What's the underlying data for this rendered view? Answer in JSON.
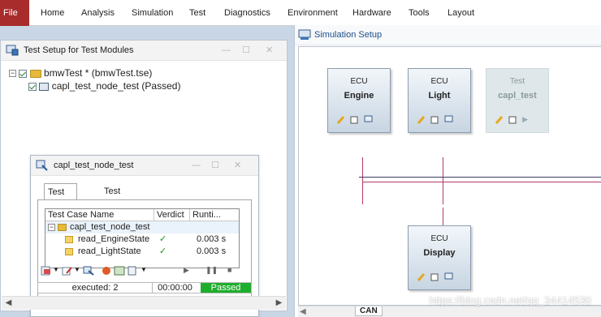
{
  "ribbon": {
    "tabs": [
      "File",
      "Home",
      "Analysis",
      "Simulation",
      "Test",
      "Diagnostics",
      "Environment",
      "Hardware",
      "Tools",
      "Layout"
    ]
  },
  "test_setup": {
    "title": "Test Setup for Test Modules",
    "tree": {
      "root_label": "bmwTest * (bmwTest.tse)",
      "child_label": "capl_test_node_test (Passed)"
    }
  },
  "test_module_window": {
    "title": "capl_test_node_test",
    "tabs": [
      "Test Cases",
      "Test Observer"
    ],
    "columns": [
      "Test Case Name",
      "Verdict",
      "Runti..."
    ],
    "group_label": "capl_test_node_test",
    "cases": [
      {
        "name": "read_EngineState",
        "verdict": "✓",
        "runtime": "0.003 s"
      },
      {
        "name": "read_LightState",
        "verdict": "✓",
        "runtime": "0.003 s"
      }
    ],
    "status": {
      "executed": "executed: 2",
      "time": "00:00:00",
      "result": "Passed"
    },
    "colors": {
      "passed": "#1ead2c",
      "tick": "#179317"
    }
  },
  "simulation_setup": {
    "title": "Simulation Setup",
    "nodes": [
      {
        "kind": "ECU",
        "name": "Engine"
      },
      {
        "kind": "ECU",
        "name": "Light"
      },
      {
        "kind": "Test",
        "name": "capl_test"
      },
      {
        "kind": "ECU",
        "name": "Display"
      }
    ],
    "bus_tab": "CAN"
  },
  "watermark": "https://blog.csdn.net/qq_34414530"
}
